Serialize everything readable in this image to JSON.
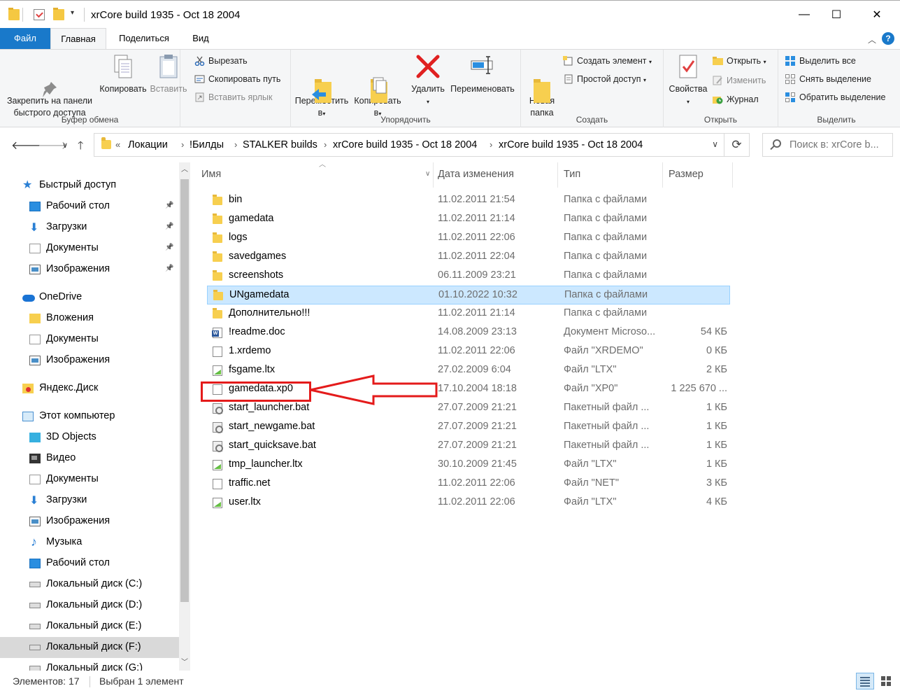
{
  "window": {
    "title": "xrCore build 1935 - Oct 18 2004",
    "minimize": "—",
    "maximize": "☐",
    "close": "✕"
  },
  "ribbon_tabs": [
    "Файл",
    "Главная",
    "Поделиться",
    "Вид"
  ],
  "ribbon": {
    "clipboard": {
      "label": "Буфер обмена",
      "pin": "Закрепить на панели\nбыстрого доступа",
      "copy": "Копировать",
      "paste": "Вставить",
      "cut": "Вырезать",
      "copy_path": "Скопировать путь",
      "paste_shortcut": "Вставить ярлык"
    },
    "organize": {
      "label": "Упорядочить",
      "move": "Переместить\nв",
      "copy_to": "Копировать\nв",
      "delete": "Удалить",
      "rename": "Переименовать"
    },
    "create": {
      "label": "Создать",
      "new_folder": "Новая\nпапка",
      "new_item": "Создать элемент",
      "easy_access": "Простой доступ"
    },
    "open": {
      "label": "Открыть",
      "properties": "Свойства",
      "open": "Открыть",
      "edit": "Изменить",
      "history": "Журнал"
    },
    "select": {
      "label": "Выделить",
      "select_all": "Выделить все",
      "select_none": "Снять выделение",
      "invert": "Обратить выделение"
    }
  },
  "address": {
    "overflow": "«",
    "crumbs": [
      "Локации",
      "!Билды",
      "STALKER builds",
      "xrCore build 1935 - Oct 18 2004",
      "xrCore build 1935 - Oct 18 2004"
    ],
    "search_placeholder": "Поиск в: xrCore b..."
  },
  "nav": {
    "items": [
      {
        "label": "Быстрый доступ",
        "icon": "quick-access-star-icon",
        "pinned": false
      },
      {
        "label": "Рабочий стол",
        "icon": "desktop-icon",
        "pinned": true
      },
      {
        "label": "Загрузки",
        "icon": "downloads-icon",
        "pinned": true
      },
      {
        "label": "Документы",
        "icon": "documents-icon",
        "pinned": true
      },
      {
        "label": "Изображения",
        "icon": "pictures-icon",
        "pinned": true
      },
      {
        "label": "OneDrive",
        "icon": "onedrive-icon",
        "pinned": false
      },
      {
        "label": "Вложения",
        "icon": "folder-icon",
        "pinned": false
      },
      {
        "label": "Документы",
        "icon": "documents-icon",
        "pinned": false
      },
      {
        "label": "Изображения",
        "icon": "pictures-icon",
        "pinned": false
      },
      {
        "label": "Яндекс.Диск",
        "icon": "yandex-disk-icon",
        "pinned": false
      },
      {
        "label": "Этот компьютер",
        "icon": "this-pc-icon",
        "pinned": false
      },
      {
        "label": "3D Objects",
        "icon": "3d-objects-icon",
        "pinned": false
      },
      {
        "label": "Видео",
        "icon": "video-icon",
        "pinned": false
      },
      {
        "label": "Документы",
        "icon": "documents-icon",
        "pinned": false
      },
      {
        "label": "Загрузки",
        "icon": "downloads-icon",
        "pinned": false
      },
      {
        "label": "Изображения",
        "icon": "pictures-icon",
        "pinned": false
      },
      {
        "label": "Музыка",
        "icon": "music-icon",
        "pinned": false
      },
      {
        "label": "Рабочий стол",
        "icon": "desktop-icon",
        "pinned": false
      },
      {
        "label": "Локальный диск (C:)",
        "icon": "drive-c-icon",
        "pinned": false
      },
      {
        "label": "Локальный диск (D:)",
        "icon": "drive-icon",
        "pinned": false
      },
      {
        "label": "Локальный диск (E:)",
        "icon": "drive-icon",
        "pinned": false
      },
      {
        "label": "Локальный диск (F:)",
        "icon": "drive-icon",
        "pinned": false
      },
      {
        "label": "Локальный диск (G:)",
        "icon": "drive-icon",
        "pinned": false
      }
    ],
    "selected": "Локальный диск (F:)"
  },
  "columns": {
    "name": "Имя",
    "date": "Дата изменения",
    "type": "Тип",
    "size": "Размер"
  },
  "files": [
    {
      "name": "bin",
      "date": "11.02.2011 21:54",
      "type": "Папка с файлами",
      "size": "",
      "kind": "folder"
    },
    {
      "name": "gamedata",
      "date": "11.02.2011 21:14",
      "type": "Папка с файлами",
      "size": "",
      "kind": "folder"
    },
    {
      "name": "logs",
      "date": "11.02.2011 22:06",
      "type": "Папка с файлами",
      "size": "",
      "kind": "folder"
    },
    {
      "name": "savedgames",
      "date": "11.02.2011 22:04",
      "type": "Папка с файлами",
      "size": "",
      "kind": "folder"
    },
    {
      "name": "screenshots",
      "date": "06.11.2009 23:21",
      "type": "Папка с файлами",
      "size": "",
      "kind": "folder"
    },
    {
      "name": "UNgamedata",
      "date": "01.10.2022 10:32",
      "type": "Папка с файлами",
      "size": "",
      "kind": "folder"
    },
    {
      "name": "Дополнительно!!!",
      "date": "11.02.2011 21:14",
      "type": "Папка с файлами",
      "size": "",
      "kind": "folder"
    },
    {
      "name": "!readme.doc",
      "date": "14.08.2009 23:13",
      "type": "Документ Microso...",
      "size": "54 КБ",
      "kind": "word"
    },
    {
      "name": "1.xrdemo",
      "date": "11.02.2011 22:06",
      "type": "Файл \"XRDEMO\"",
      "size": "0 КБ",
      "kind": "file"
    },
    {
      "name": "fsgame.ltx",
      "date": "27.02.2009 6:04",
      "type": "Файл \"LTX\"",
      "size": "2 КБ",
      "kind": "ltx"
    },
    {
      "name": "gamedata.xp0",
      "date": "17.10.2004 18:18",
      "type": "Файл \"XP0\"",
      "size": "1 225 670 ...",
      "kind": "file"
    },
    {
      "name": "start_launcher.bat",
      "date": "27.07.2009 21:21",
      "type": "Пакетный файл ...",
      "size": "1 КБ",
      "kind": "bat"
    },
    {
      "name": "start_newgame.bat",
      "date": "27.07.2009 21:21",
      "type": "Пакетный файл ...",
      "size": "1 КБ",
      "kind": "bat"
    },
    {
      "name": "start_quicksave.bat",
      "date": "27.07.2009 21:21",
      "type": "Пакетный файл ...",
      "size": "1 КБ",
      "kind": "bat"
    },
    {
      "name": "tmp_launcher.ltx",
      "date": "30.10.2009 21:45",
      "type": "Файл \"LTX\"",
      "size": "1 КБ",
      "kind": "ltx"
    },
    {
      "name": "traffic.net",
      "date": "11.02.2011 22:06",
      "type": "Файл \"NET\"",
      "size": "3 КБ",
      "kind": "file"
    },
    {
      "name": "user.ltx",
      "date": "11.02.2011 22:06",
      "type": "Файл \"LTX\"",
      "size": "4 КБ",
      "kind": "ltx"
    }
  ],
  "selected_file": "UNgamedata",
  "highlighted_file": "gamedata.xp0",
  "status": {
    "count": "Элементов: 17",
    "selected": "Выбран 1 элемент"
  },
  "colors": {
    "accent": "#1979ca",
    "selection": "#cce8ff",
    "annotation": "#e41b1b"
  }
}
